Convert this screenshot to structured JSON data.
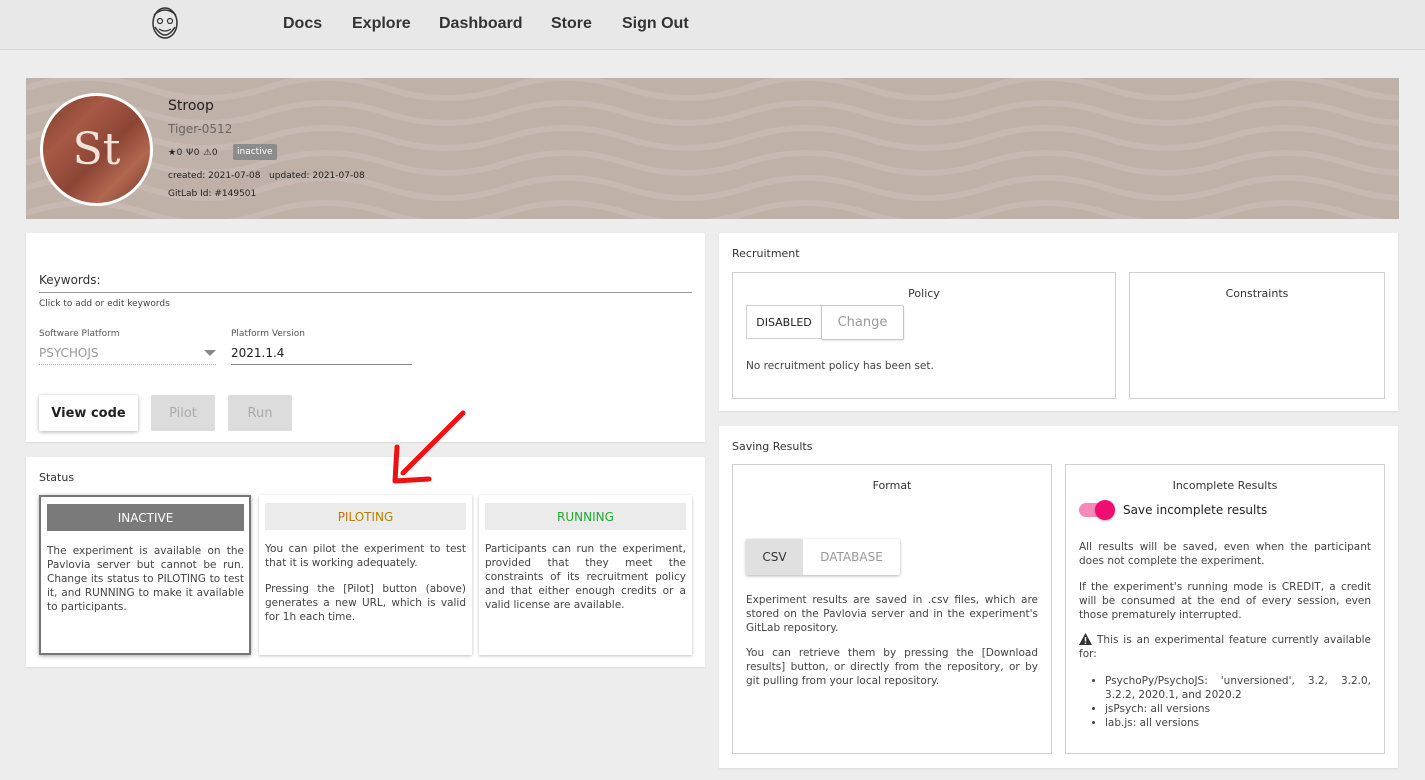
{
  "nav": {
    "logo_icon": "bearded-face-logo",
    "links": [
      "Docs",
      "Explore",
      "Dashboard",
      "Store",
      "Sign Out"
    ]
  },
  "project": {
    "avatar_initials": "St",
    "title": "Stroop",
    "owner": "Tiger-0512",
    "stats": "★0 Ψ0 ⚠0",
    "status_badge": "inactive",
    "dates": "created: 2021-07-08   updated: 2021-07-08",
    "gitlab_id": "GitLab Id: #149501"
  },
  "settings": {
    "keywords_label": "Keywords:",
    "keywords_help": "Click to add or edit keywords",
    "platform_label": "Software Platform",
    "platform_value": "PSYCHOJS",
    "version_label": "Platform Version",
    "version_value": "2021.1.4",
    "view_code": "View code",
    "pilot": "Pilot",
    "run": "Run"
  },
  "status": {
    "title": "Status",
    "cards": [
      {
        "label": "INACTIVE",
        "text": "The experiment is available on the Pavlovia server but cannot be run. Change its status to PILOTING to test it, and RUNNING to make it available to participants."
      },
      {
        "label": "PILOTING",
        "text": "You can pilot the experiment to test that it is working adequately.",
        "text2": "Pressing the [Pilot] button (above) generates a new URL, which is valid for 1h each time."
      },
      {
        "label": "RUNNING",
        "text": "Participants can run the experiment, provided that they meet the constraints of its recruitment policy and that either enough credits or a valid license are available."
      }
    ],
    "colors": {
      "inactive_bg": "#7a7a7a",
      "piloting": "#c47a00",
      "running": "#1faa2e"
    }
  },
  "recruitment": {
    "title": "Recruitment",
    "policy_title": "Policy",
    "policy_value": "DISABLED",
    "change": "Change",
    "policy_note": "No recruitment policy has been set.",
    "constraints_title": "Constraints"
  },
  "saving": {
    "title": "Saving Results",
    "format_title": "Format",
    "csv": "CSV",
    "database": "DATABASE",
    "format_text1": "Experiment results are saved in .csv files, which are stored on the Pavlovia server and in the experiment's GitLab repository.",
    "format_text2": "You can retrieve them by pressing the [Download results] button, or directly from the repository, or by git pulling from your local repository.",
    "incomplete_title": "Incomplete Results",
    "toggle_label": "Save incomplete results",
    "toggle_on": true,
    "accent_color": "#ef0d72",
    "inc_text1": "All results will be saved, even when the participant does not complete the experiment.",
    "inc_text2": "If the experiment's running mode is CREDIT, a credit will be consumed at the end of every session, even those prematurely interrupted.",
    "warning": "This is an experimental feature currently available for:",
    "versions": [
      "PsychoPy/PsychoJS: 'unversioned', 3.2, 3.2.0, 3.2.2, 2020.1, and 2020.2",
      "jsPsych: all versions",
      "lab.js: all versions"
    ]
  }
}
